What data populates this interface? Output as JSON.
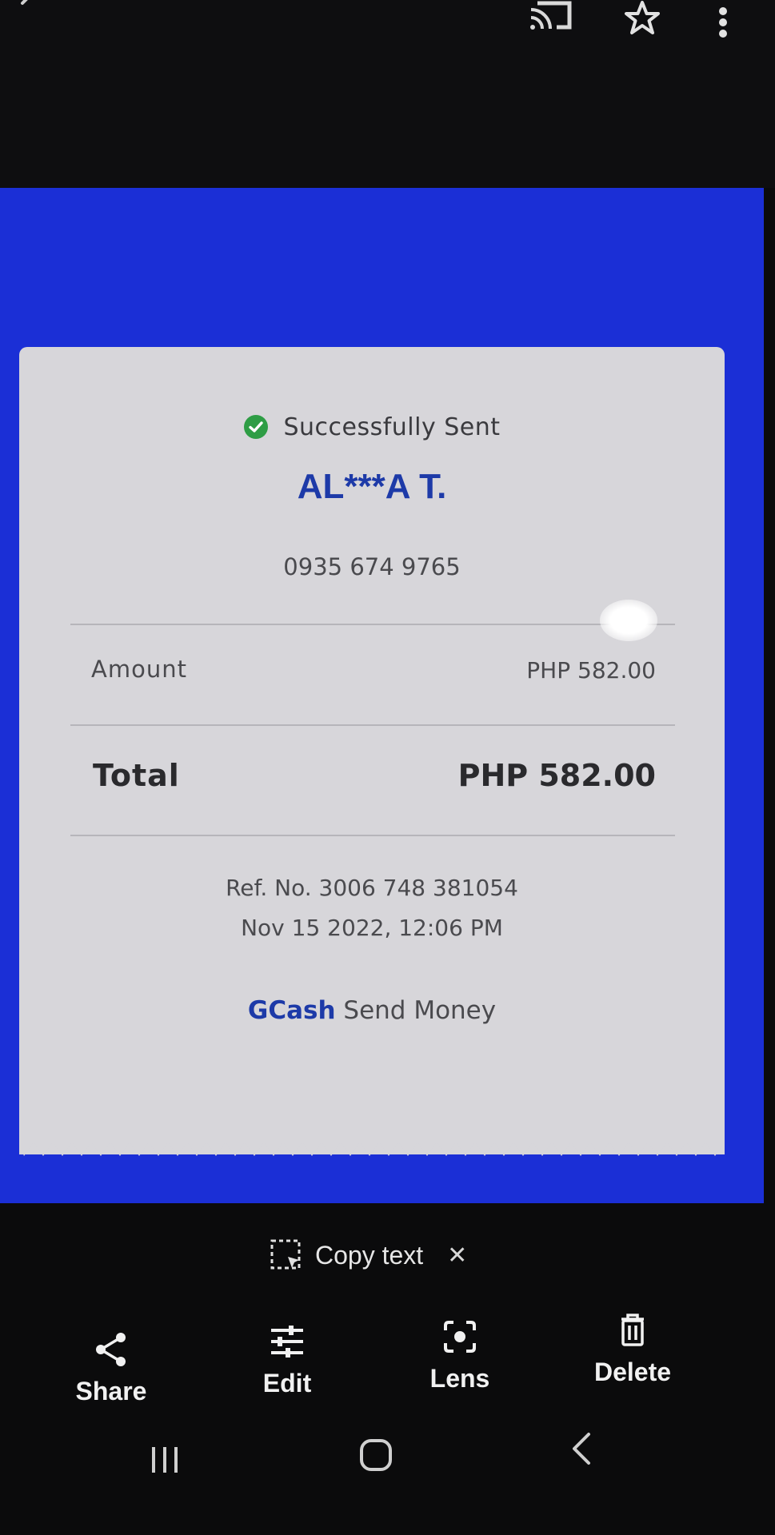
{
  "receipt": {
    "status": "Successfully Sent",
    "recipient_name": "AL***A T.",
    "recipient_phone": "0935 674 9765",
    "amount_label": "Amount",
    "amount_value": "PHP 582.00",
    "total_label": "Total",
    "total_value": "PHP 582.00",
    "ref_no": "Ref. No. 3006 748 381054",
    "datetime": "Nov 15 2022, 12:06 PM",
    "brand": "GCash",
    "service": "Send Money"
  },
  "copy_text": {
    "label": "Copy text",
    "close_glyph": "✕"
  },
  "actions": [
    {
      "label": "Share",
      "icon": "share-icon"
    },
    {
      "label": "Edit",
      "icon": "sliders-icon"
    },
    {
      "label": "Lens",
      "icon": "lens-icon"
    },
    {
      "label": "Delete",
      "icon": "trash-icon"
    }
  ],
  "nav": {
    "recent_icon": "recent-apps-icon",
    "home_icon": "home-icon",
    "back_icon": "back-icon"
  },
  "colors": {
    "banner_blue": "#1b2fd6",
    "brand_blue": "#1d3aa8",
    "success_green": "#2e9d45",
    "receipt_bg": "#d7d6da"
  }
}
